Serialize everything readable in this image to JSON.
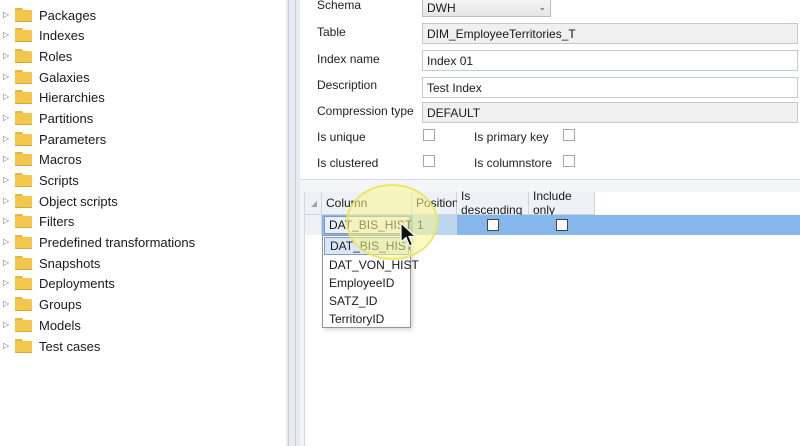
{
  "tree": {
    "items": [
      {
        "label": "Packages"
      },
      {
        "label": "Indexes"
      },
      {
        "label": "Roles"
      },
      {
        "label": "Galaxies"
      },
      {
        "label": "Hierarchies"
      },
      {
        "label": "Partitions"
      },
      {
        "label": "Parameters"
      },
      {
        "label": "Macros"
      },
      {
        "label": "Scripts"
      },
      {
        "label": "Object scripts"
      },
      {
        "label": "Filters"
      },
      {
        "label": "Predefined transformations"
      },
      {
        "label": "Snapshots"
      },
      {
        "label": "Deployments"
      },
      {
        "label": "Groups"
      },
      {
        "label": "Models"
      },
      {
        "label": "Test cases"
      }
    ]
  },
  "properties": {
    "schema_label": "Schema",
    "schema_value": "DWH",
    "table_label": "Table",
    "table_value": "DIM_EmployeeTerritories_T",
    "index_name_label": "Index name",
    "index_name_value": "Index 01",
    "description_label": "Description",
    "description_value": "Test Index",
    "compression_label": "Compression type",
    "compression_value": "DEFAULT",
    "is_unique_label": "Is unique",
    "is_primary_key_label": "Is primary key",
    "is_clustered_label": "Is clustered",
    "is_columnstore_label": "Is columnstore"
  },
  "grid": {
    "headers": [
      "Column",
      "Position",
      "Is descending",
      "Include only"
    ],
    "row": {
      "column_value": "DAT_BIS_HIST",
      "position_value": "1"
    }
  },
  "dropdown": {
    "options": [
      "DAT_BIS_HIST",
      "DAT_VON_HIST",
      "EmployeeID",
      "SATZ_ID",
      "TerritoryID"
    ],
    "selected_index": 0
  },
  "colors": {
    "selection_row": "#86b7ec",
    "folder": "#f3c74c",
    "highlight": "#faf68c"
  }
}
